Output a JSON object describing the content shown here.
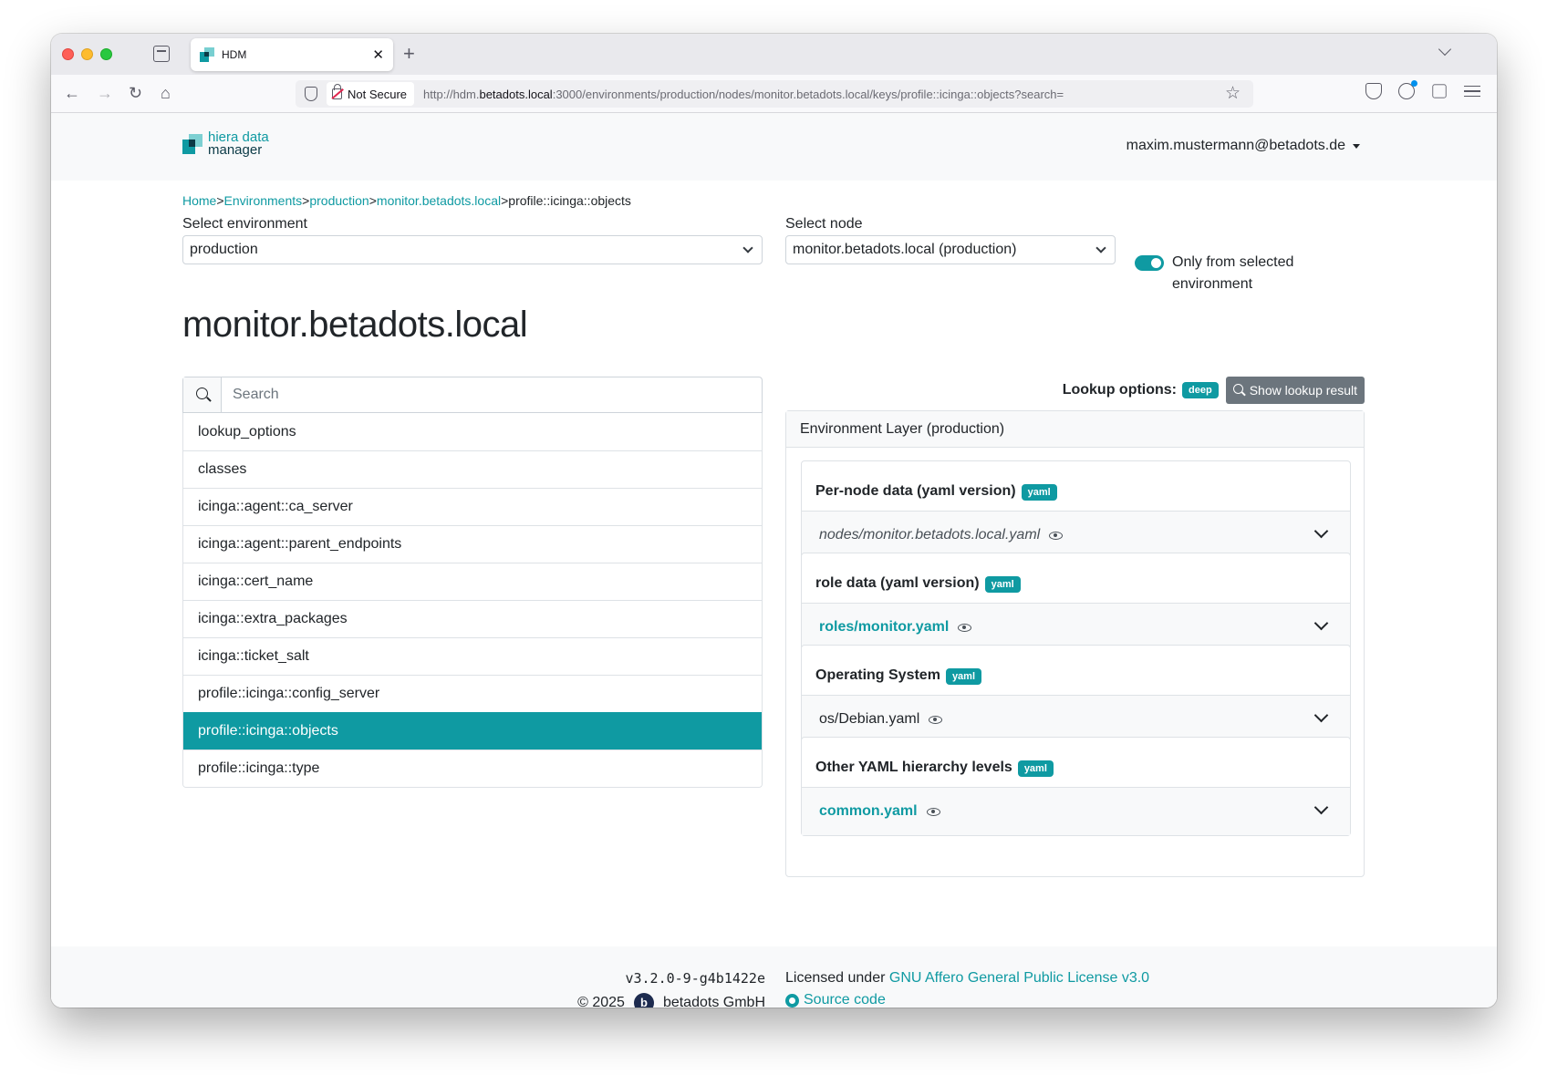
{
  "browser": {
    "tab_title": "HDM",
    "security_label": "Not Secure",
    "url_prefix": "http://hdm.",
    "url_domain": "betadots.local",
    "url_rest": ":3000/environments/production/nodes/monitor.betadots.local/keys/profile::icinga::objects?search="
  },
  "header": {
    "logo_line1": "hiera data",
    "logo_line2": "manager",
    "user": "maxim.mustermann@betadots.de"
  },
  "breadcrumb": {
    "items": [
      "Home",
      "Environments",
      "production",
      "monitor.betadots.local"
    ],
    "separator": ">",
    "current": "profile::icinga::objects"
  },
  "filters": {
    "env_label": "Select environment",
    "env_value": "production",
    "node_label": "Select node",
    "node_value": "monitor.betadots.local (production)",
    "toggle_label": "Only from selected environment",
    "toggle_on": true
  },
  "node_title": "monitor.betadots.local",
  "search": {
    "placeholder": "Search"
  },
  "keys": [
    "lookup_options",
    "classes",
    "icinga::agent::ca_server",
    "icinga::agent::parent_endpoints",
    "icinga::cert_name",
    "icinga::extra_packages",
    "icinga::ticket_salt",
    "profile::icinga::config_server",
    "profile::icinga::objects",
    "profile::icinga::type"
  ],
  "active_key_index": 8,
  "lookup": {
    "label": "Lookup options:",
    "badge": "deep",
    "button": "Show lookup result"
  },
  "layer": {
    "title": "Environment Layer (production)",
    "hierarchies": [
      {
        "title": "Per-node data (yaml version)",
        "badge": "yaml",
        "file": "nodes/monitor.betadots.local.yaml",
        "style": "italic"
      },
      {
        "title": "role data (yaml version)",
        "badge": "yaml",
        "file": "roles/monitor.yaml",
        "style": "link"
      },
      {
        "title": "Operating System",
        "badge": "yaml",
        "file": "os/Debian.yaml",
        "style": "plain"
      },
      {
        "title": "Other YAML hierarchy levels",
        "badge": "yaml",
        "file": "common.yaml",
        "style": "link"
      }
    ]
  },
  "footer": {
    "version": "v3.2.0-9-g4b1422e",
    "copyright": "© 2025",
    "company": "betadots GmbH",
    "license_prefix": "Licensed under",
    "license_link": "GNU Affero General Public License v3.0",
    "source": "Source code"
  },
  "colors": {
    "accent": "#0f9aa2",
    "secondary": "#6c757d"
  }
}
